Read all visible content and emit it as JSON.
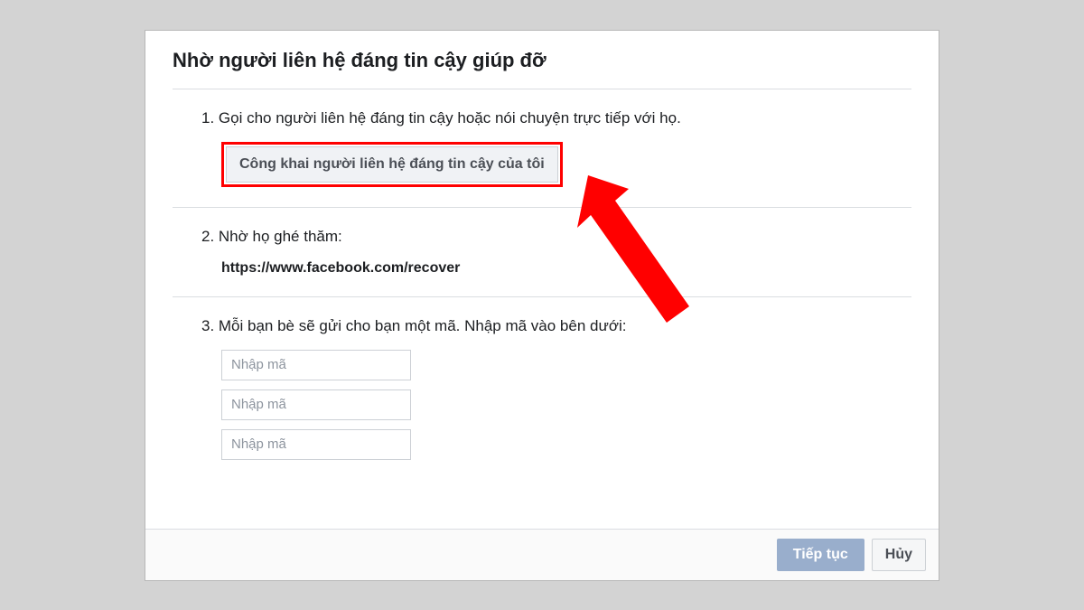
{
  "dialog": {
    "title": "Nhờ người liên hệ đáng tin cậy giúp đỡ",
    "step1": {
      "text": "1. Gọi cho người liên hệ đáng tin cậy hoặc nói chuyện trực tiếp với họ.",
      "button_label": "Công khai người liên hệ đáng tin cậy của tôi"
    },
    "step2": {
      "text": "2. Nhờ họ ghé thăm:",
      "url": "https://www.facebook.com/recover"
    },
    "step3": {
      "text": "3. Mỗi bạn bè sẽ gửi cho bạn một mã. Nhập mã vào bên dưới:",
      "placeholder": "Nhập mã"
    },
    "footer": {
      "primary": "Tiếp tục",
      "secondary": "Hủy"
    }
  },
  "annotation": {
    "arrow_color": "#ff0000"
  }
}
